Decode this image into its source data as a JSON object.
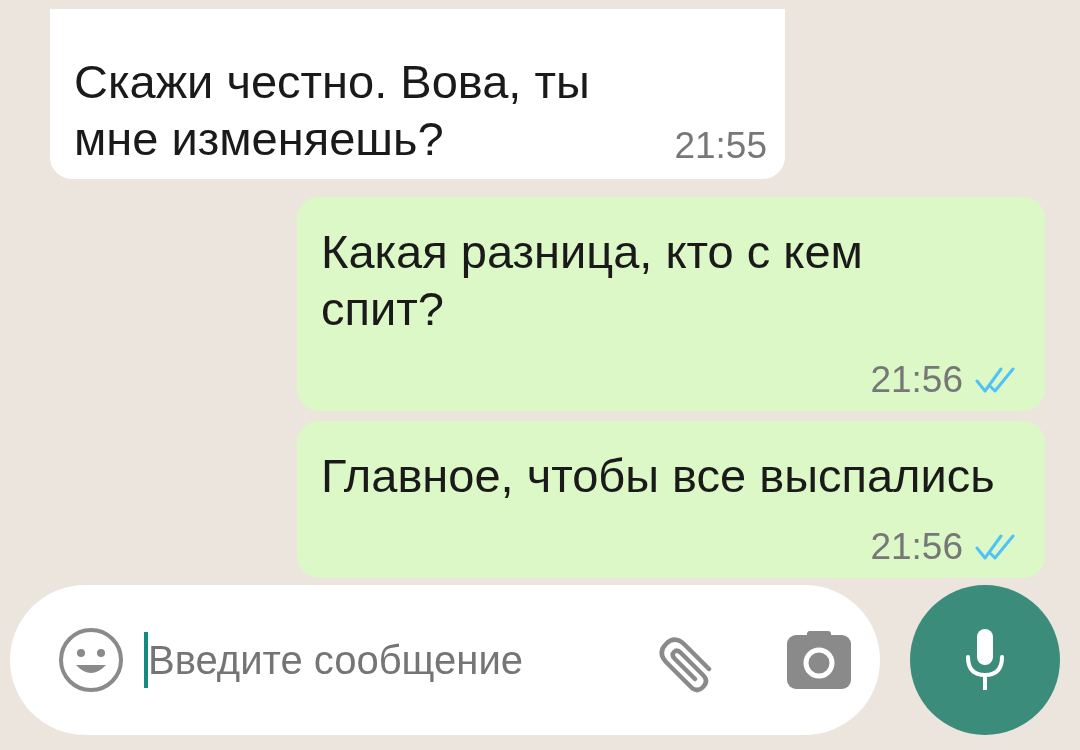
{
  "messages": [
    {
      "kind": "incoming",
      "text": "Скажи честно. Вова, ты\nмне изменяешь?",
      "time": "21:55"
    },
    {
      "kind": "outgoing",
      "text": "Какая разница, кто с кем\nспит?",
      "time": "21:56",
      "read": true
    },
    {
      "kind": "outgoing",
      "text": "Главное, чтобы все выспались",
      "time": "21:56",
      "read": true
    }
  ],
  "composer": {
    "placeholder": "Введите сообщение"
  }
}
